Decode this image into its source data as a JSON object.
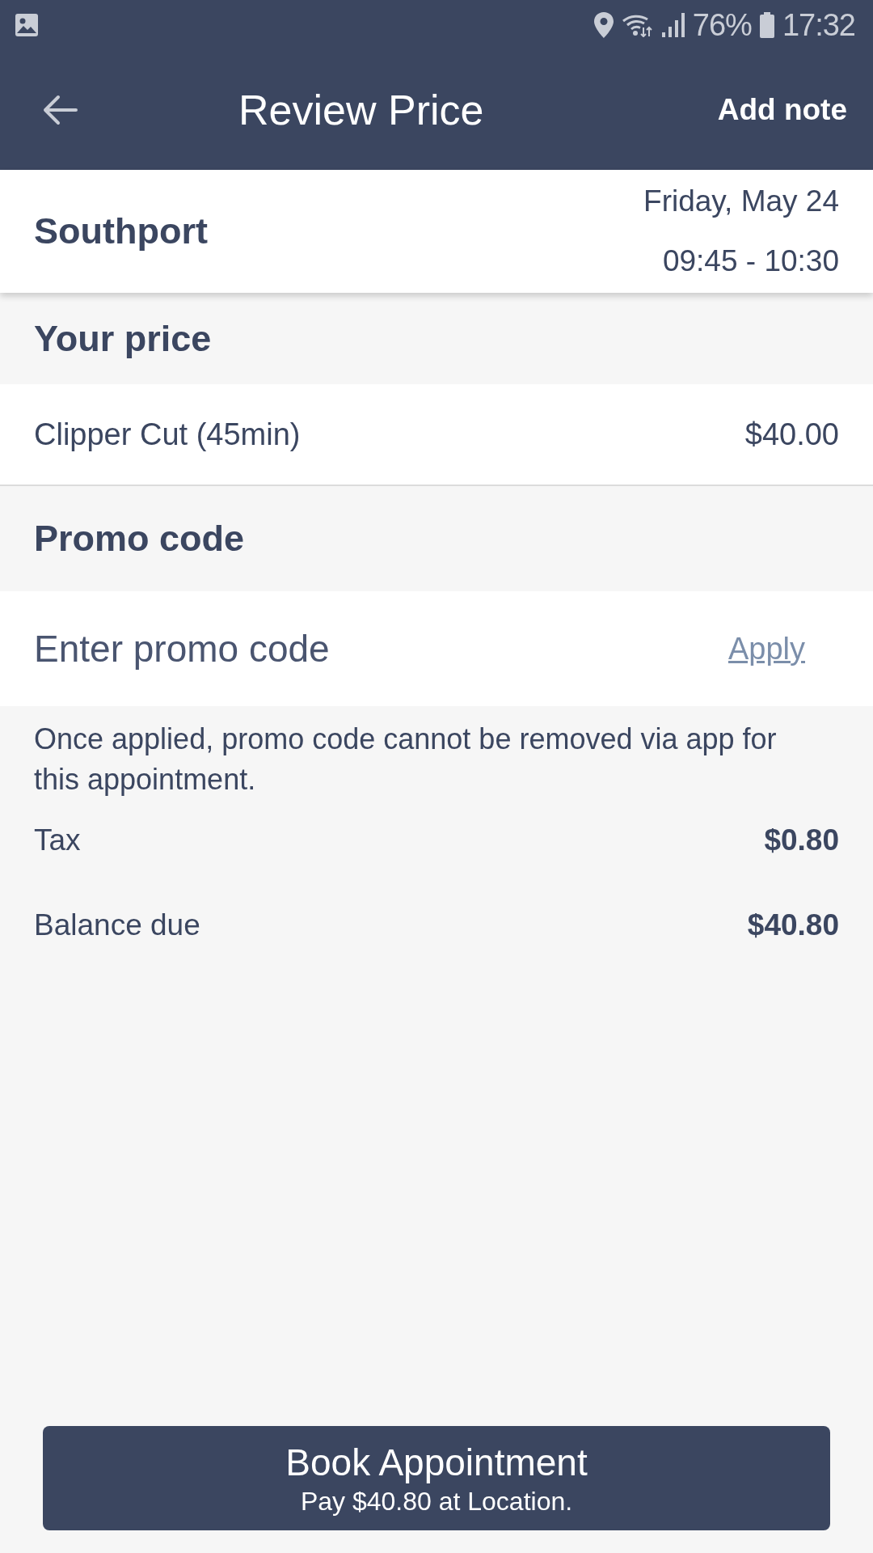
{
  "status_bar": {
    "battery": "76%",
    "time": "17:32"
  },
  "header": {
    "title": "Review Price",
    "action": "Add note"
  },
  "appointment": {
    "location": "Southport",
    "date": "Friday, May 24",
    "time": "09:45 - 10:30"
  },
  "price_section": {
    "heading": "Your price",
    "items": [
      {
        "name": "Clipper Cut (45min)",
        "price": "$40.00"
      }
    ]
  },
  "promo_section": {
    "heading": "Promo code",
    "field": {
      "placeholder": "Enter promo code"
    },
    "apply": "Apply",
    "note": "Once applied, promo code cannot be removed via app for this appointment."
  },
  "totals": [
    {
      "label": "Tax",
      "amount": "$0.80"
    },
    {
      "label": "Balance due",
      "amount": "$40.80"
    }
  ],
  "book_button": {
    "label": "Book Appointment",
    "sublabel": "Pay $40.80 at Location."
  }
}
